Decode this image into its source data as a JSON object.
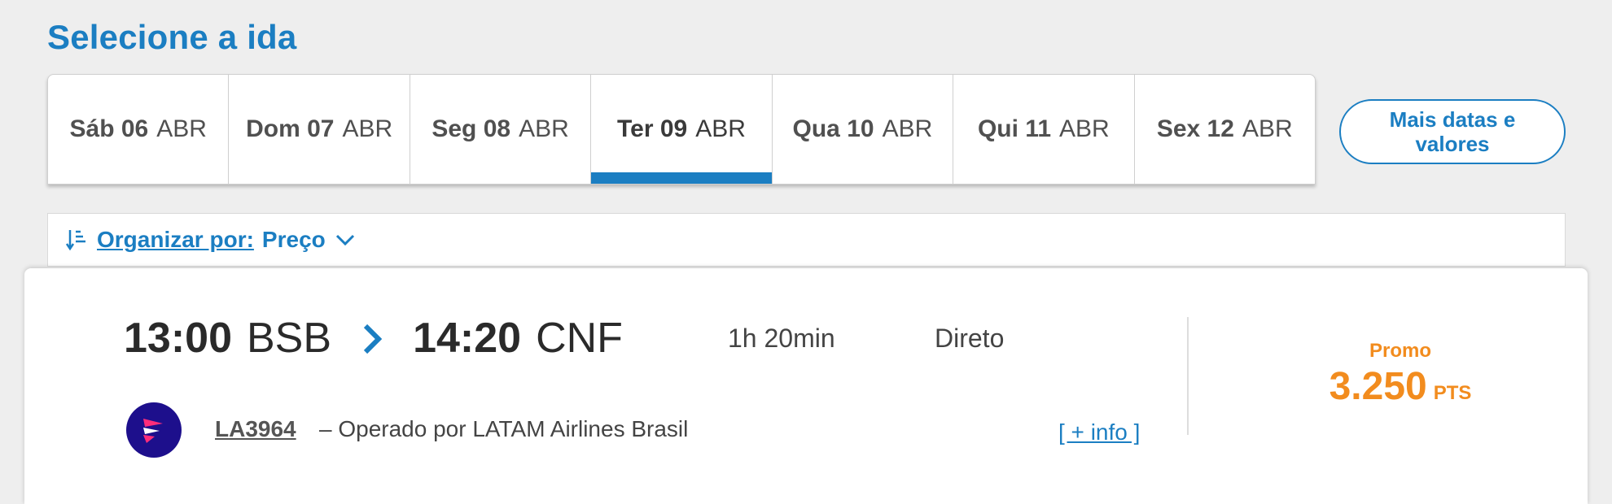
{
  "page": {
    "title": "Selecione a ida"
  },
  "date_tabs": [
    {
      "day": "Sáb 06",
      "month": "ABR",
      "active": false
    },
    {
      "day": "Dom 07",
      "month": "ABR",
      "active": false
    },
    {
      "day": "Seg 08",
      "month": "ABR",
      "active": false
    },
    {
      "day": "Ter 09",
      "month": "ABR",
      "active": true
    },
    {
      "day": "Qua 10",
      "month": "ABR",
      "active": false
    },
    {
      "day": "Qui 11",
      "month": "ABR",
      "active": false
    },
    {
      "day": "Sex 12",
      "month": "ABR",
      "active": false
    }
  ],
  "more_dates": {
    "line1": "Mais datas e",
    "line2": "valores"
  },
  "sort": {
    "label": "Organizar por:",
    "value": "Preço",
    "icon": "sort-icon"
  },
  "flight": {
    "departure_time": "13:00",
    "departure_airport": "BSB",
    "arrival_time": "14:20",
    "arrival_airport": "CNF",
    "duration": "1h 20min",
    "stops": "Direto",
    "flight_number": "LA3964",
    "operated_by": "– Operado por LATAM Airlines Brasil",
    "more_info": "[ + info ]",
    "fare_label": "Promo",
    "price": "3.250",
    "price_unit": "PTS"
  },
  "colors": {
    "accent": "#1b7ec2",
    "price": "#f28c1e",
    "airline_logo_bg": "#1d0f8c"
  }
}
